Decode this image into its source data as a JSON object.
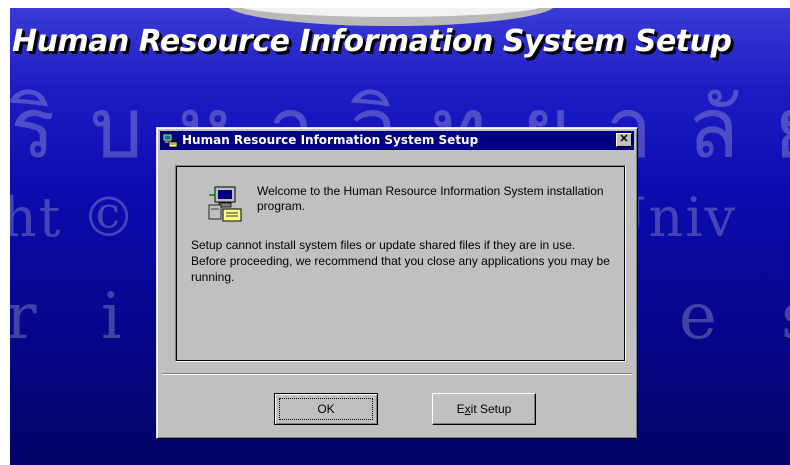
{
  "background": {
    "title": "Human Resource Information System Setup",
    "watermark_lines": [
      "ริ บ ห า วิ ท ย า ลั ย เ ชี ย ง ใ",
      "ht © by Chiang Mai Univ",
      "r i g h t s   r e s e r v"
    ],
    "gradient_top": "#3a3ad6",
    "gradient_bottom": "#040468"
  },
  "dialog": {
    "title": "Human Resource Information System Setup",
    "close_glyph": "✕",
    "welcome_text": "Welcome to the Human Resource Information System installation program.",
    "warning_text": "Setup cannot install system files or update shared files if they are in use. Before proceeding, we recommend that you close any applications you may be running.",
    "buttons": {
      "ok_label": "OK",
      "exit_label_prefix": "E",
      "exit_label_access": "x",
      "exit_label_suffix": "it Setup"
    },
    "colors": {
      "titlebar": "#000080",
      "face": "#c0c0c0"
    },
    "icons": {
      "app": "setup-computer-icon",
      "close": "close-icon"
    }
  }
}
